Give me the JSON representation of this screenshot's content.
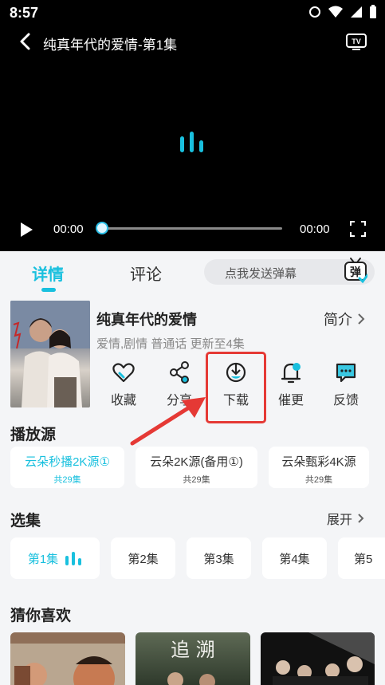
{
  "status_bar": {
    "time": "8:57"
  },
  "player": {
    "title": "纯真年代的爱情-第1集",
    "current_time": "00:00",
    "total_time": "00:00",
    "progress": 0
  },
  "tabs": {
    "detail": "详情",
    "comments": "评论"
  },
  "danmaku": {
    "placeholder": "点我发送弹幕",
    "icon_label": "弹"
  },
  "show": {
    "title": "纯真年代的爱情",
    "intro_link": "简介",
    "meta": "爱情,剧情 普通话 更新至4集"
  },
  "actions": [
    {
      "label": "收藏",
      "icon": "heart-icon"
    },
    {
      "label": "分享",
      "icon": "share-icon"
    },
    {
      "label": "下载",
      "icon": "download-icon"
    },
    {
      "label": "催更",
      "icon": "bell-icon"
    },
    {
      "label": "反馈",
      "icon": "feedback-icon"
    }
  ],
  "sources": {
    "title": "播放源",
    "items": [
      {
        "name": "云朵秒播2K源①",
        "count": "共29集",
        "active": true
      },
      {
        "name": "云朵2K源(备用①)",
        "count": "共29集",
        "active": false
      },
      {
        "name": "云朵甄彩4K源",
        "count": "共29集",
        "active": false
      }
    ]
  },
  "episodes": {
    "title": "选集",
    "expand_label": "展开",
    "items": [
      {
        "label": "第1集",
        "active": true
      },
      {
        "label": "第2集",
        "active": false
      },
      {
        "label": "第3集",
        "active": false
      },
      {
        "label": "第4集",
        "active": false
      },
      {
        "label": "第5",
        "active": false
      }
    ]
  },
  "recommendations": {
    "title": "猜你喜欢",
    "card2_art_text": "追 溯"
  },
  "colors": {
    "accent": "#19c0de",
    "highlight": "#e53935",
    "player_bg": "#000000"
  }
}
